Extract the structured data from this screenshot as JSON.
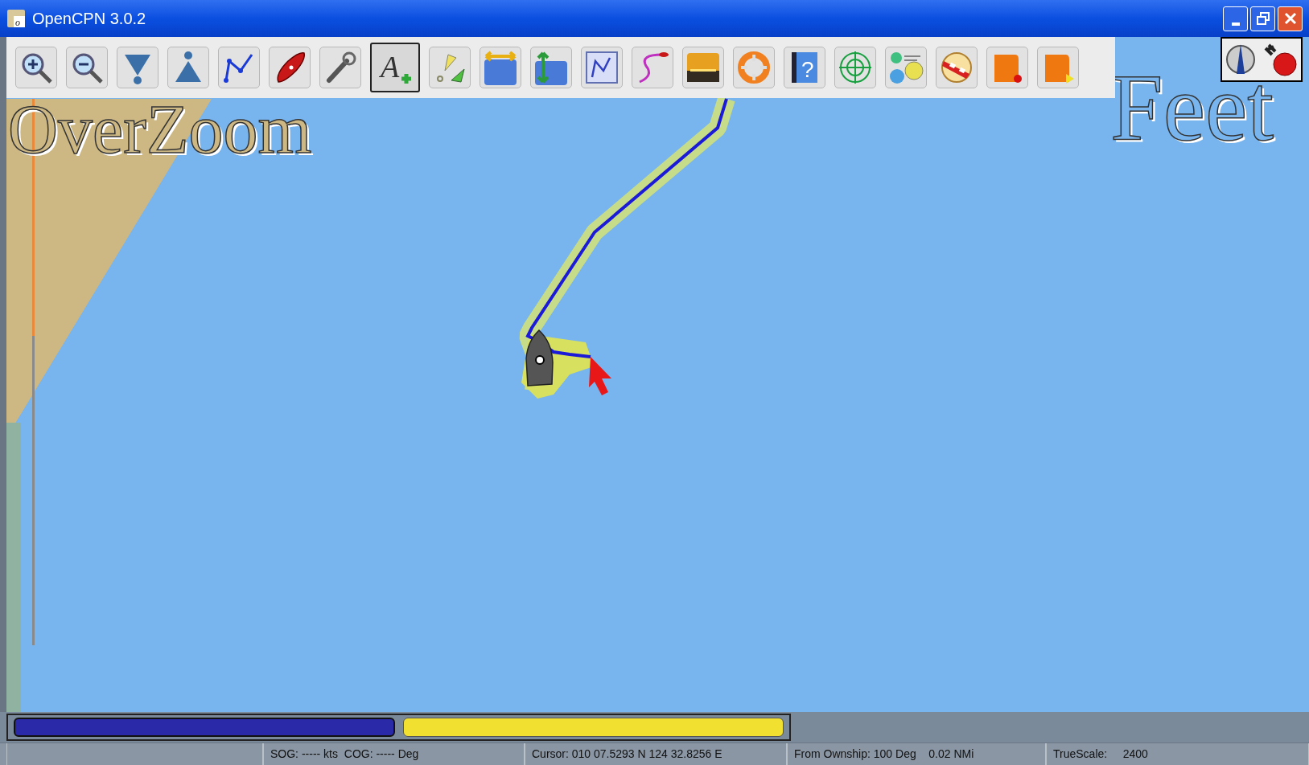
{
  "window": {
    "title": "OpenCPN 3.0.2",
    "app_icon_glyph": "o"
  },
  "toolbar": {
    "tools": [
      {
        "selected": false
      },
      {
        "selected": false
      },
      {
        "selected": false
      },
      {
        "selected": false
      },
      {
        "selected": false
      },
      {
        "selected": false
      },
      {
        "selected": false
      },
      {
        "selected": true,
        "glyph": "A"
      },
      {
        "selected": false
      },
      {
        "selected": false
      },
      {
        "selected": false
      },
      {
        "selected": false
      },
      {
        "selected": false
      },
      {
        "selected": false
      },
      {
        "selected": false
      },
      {
        "selected": false,
        "glyph": "?"
      },
      {
        "selected": false
      },
      {
        "selected": false
      },
      {
        "selected": false
      },
      {
        "selected": false
      },
      {
        "selected": false
      }
    ]
  },
  "chart": {
    "overzoom_label": "OverZoom",
    "units_label": "Feet"
  },
  "chart_bar": [
    {
      "color": "#2a2aa8",
      "selected": true
    },
    {
      "color": "#f2e030",
      "selected": false
    }
  ],
  "status_bar": [
    "SOG: ----- kts  COG: ----- Deg",
    "Cursor: 010 07.5293 N 124 32.8256 E",
    "From Ownship: 100 Deg    0.02 NMi",
    "TrueScale:     2400"
  ]
}
